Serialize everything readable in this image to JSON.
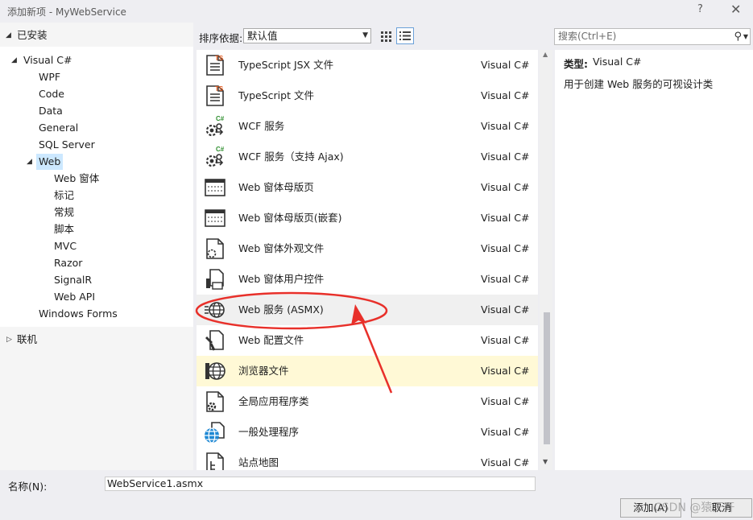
{
  "window": {
    "title": "添加新项 - MyWebService",
    "help": "?",
    "close": "✕"
  },
  "left": {
    "installed": "已安装",
    "tree": [
      {
        "label": "Visual C#",
        "indent": 0,
        "expanded": true
      },
      {
        "label": "WPF",
        "indent": 1
      },
      {
        "label": "Code",
        "indent": 1
      },
      {
        "label": "Data",
        "indent": 1
      },
      {
        "label": "General",
        "indent": 1
      },
      {
        "label": "SQL Server",
        "indent": 1
      },
      {
        "label": "Web",
        "indent": 1,
        "expanded": true,
        "selected": true
      },
      {
        "label": "Web 窗体",
        "indent": 2
      },
      {
        "label": "标记",
        "indent": 2
      },
      {
        "label": "常规",
        "indent": 2
      },
      {
        "label": "脚本",
        "indent": 2
      },
      {
        "label": "MVC",
        "indent": 2
      },
      {
        "label": "Razor",
        "indent": 2
      },
      {
        "label": "SignalR",
        "indent": 2
      },
      {
        "label": "Web API",
        "indent": 2
      },
      {
        "label": "Windows Forms",
        "indent": 1
      }
    ],
    "online": "联机"
  },
  "toolbar": {
    "sort_label": "排序依据:",
    "sort_value": "默认值",
    "search_placeholder": "搜索(Ctrl+E)"
  },
  "items": [
    {
      "name": "TypeScript JSX 文件",
      "lang": "Visual C#",
      "icon": "typescript-jsx-icon"
    },
    {
      "name": "TypeScript 文件",
      "lang": "Visual C#",
      "icon": "typescript-file-icon"
    },
    {
      "name": "WCF 服务",
      "lang": "Visual C#",
      "icon": "wcf-service-icon"
    },
    {
      "name": "WCF 服务（支持 Ajax)",
      "lang": "Visual C#",
      "icon": "wcf-ajax-service-icon"
    },
    {
      "name": "Web 窗体母版页",
      "lang": "Visual C#",
      "icon": "master-page-icon"
    },
    {
      "name": "Web 窗体母版页(嵌套)",
      "lang": "Visual C#",
      "icon": "nested-master-page-icon"
    },
    {
      "name": "Web 窗体外观文件",
      "lang": "Visual C#",
      "icon": "skin-file-icon"
    },
    {
      "name": "Web 窗体用户控件",
      "lang": "Visual C#",
      "icon": "user-control-icon"
    },
    {
      "name": "Web 服务 (ASMX)",
      "lang": "Visual C#",
      "icon": "web-service-icon"
    },
    {
      "name": "Web 配置文件",
      "lang": "Visual C#",
      "icon": "web-config-icon"
    },
    {
      "name": "浏览器文件",
      "lang": "Visual C#",
      "icon": "browser-file-icon"
    },
    {
      "name": "全局应用程序类",
      "lang": "Visual C#",
      "icon": "global-app-class-icon"
    },
    {
      "name": "一般处理程序",
      "lang": "Visual C#",
      "icon": "generic-handler-icon"
    },
    {
      "name": "站点地图",
      "lang": "Visual C#",
      "icon": "sitemap-icon"
    }
  ],
  "details": {
    "type_label": "类型:",
    "type_value": "Visual C#",
    "description": "用于创建 Web 服务的可视设计类"
  },
  "bottom": {
    "name_label": "名称(N):",
    "name_value": "WebService1.asmx",
    "add_button": "添加(A)",
    "cancel_button": "取消",
    "watermark": "CSDN @猿天开"
  },
  "colors": {
    "selection": "#fff9d6",
    "tree_selection": "#cce8ff",
    "annotation": "#e8302a",
    "ts_badge": "#e05a1e",
    "csharp_badge": "#2f8f2f",
    "globe": "#1e88d4"
  }
}
